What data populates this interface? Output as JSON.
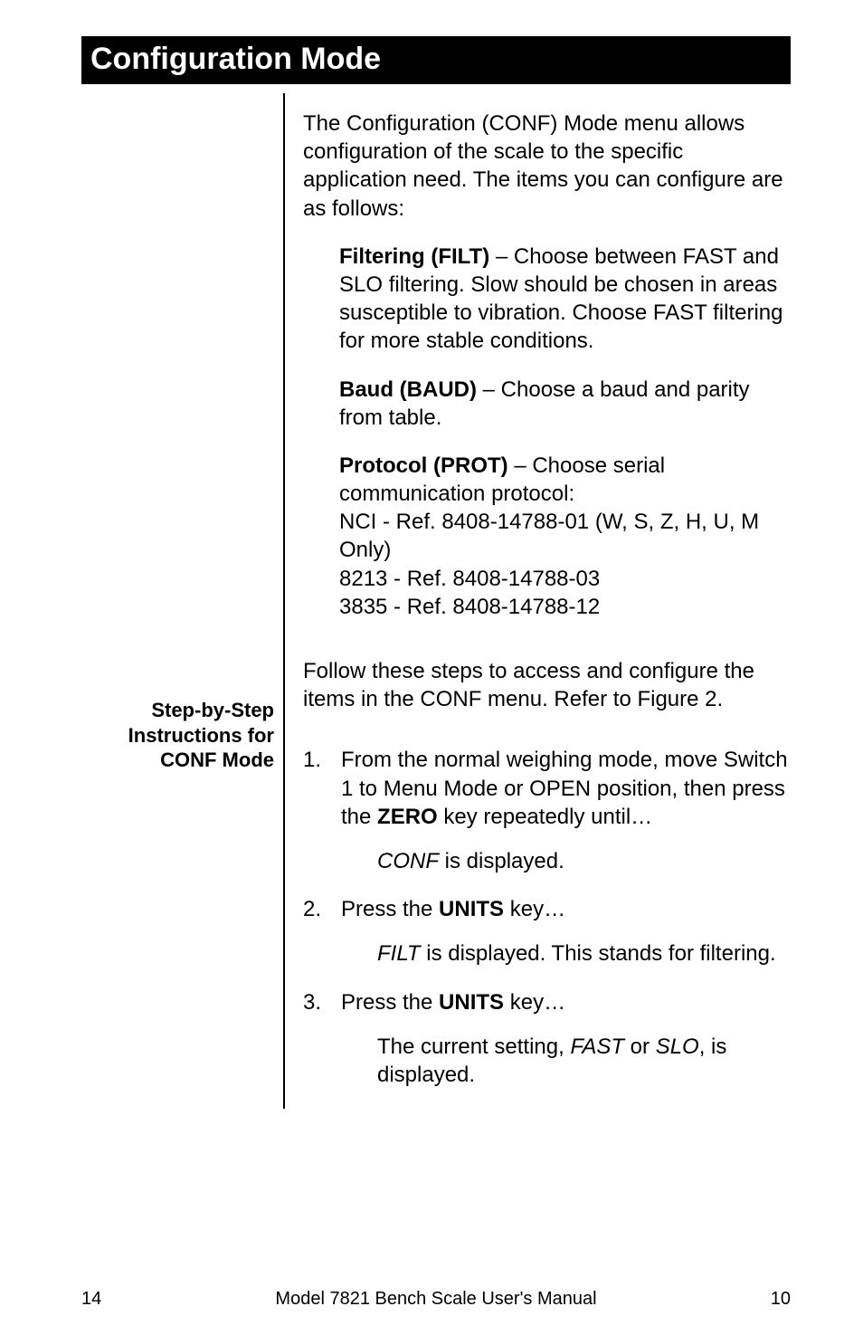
{
  "title": "Configuration Mode",
  "intro": "The Configuration (CONF) Mode menu allows configuration of the scale to the specific application need. The items you can configure are as follows:",
  "filt_head": "Filtering (FILT)",
  "filt_body": " – Choose between FAST and SLO filtering. Slow should be chosen in areas susceptible to vibration. Choose FAST filtering for more stable conditions.",
  "baud_head": "Baud (BAUD)",
  "baud_body": " – Choose a baud and parity from table.",
  "prot_head": "Protocol (PROT)",
  "prot_body1": " – Choose serial communication protocol:",
  "prot_line1": "NCI - Ref. 8408-14788-01 (W, S, Z, H, U, M Only)",
  "prot_line2": "8213 - Ref. 8408-14788-03",
  "prot_line3": "3835 - Ref. 8408-14788-12",
  "side_l1": "Step-by-Step",
  "side_l2": "Instructions for",
  "side_l3": "CONF Mode",
  "follow": "Follow these steps to access and configure the items in the CONF menu. Refer to Figure 2.",
  "s1_num": "1.",
  "s1_a": "From the normal weighing mode, move Switch 1 to Menu Mode or OPEN position, then press the ",
  "s1_key": "ZERO",
  "s1_b": " key repeatedly until…",
  "s1_sub_i": "CONF",
  "s1_sub_r": " is displayed.",
  "s2_num": "2.",
  "s2_a": "Press the ",
  "s2_key": "UNITS",
  "s2_b": " key…",
  "s2_sub_i": "FILT",
  "s2_sub_r": " is displayed. This stands for filtering.",
  "s3_num": "3.",
  "s3_a": "Press the ",
  "s3_key": "UNITS",
  "s3_b": " key…",
  "s3_sub_a": "The current setting, ",
  "s3_sub_i1": "FAST",
  "s3_sub_m": " or ",
  "s3_sub_i2": "SLO",
  "s3_sub_b": ", is displayed.",
  "footer_left": "14",
  "footer_center": "Model 7821 Bench Scale User's Manual",
  "footer_right": "10"
}
